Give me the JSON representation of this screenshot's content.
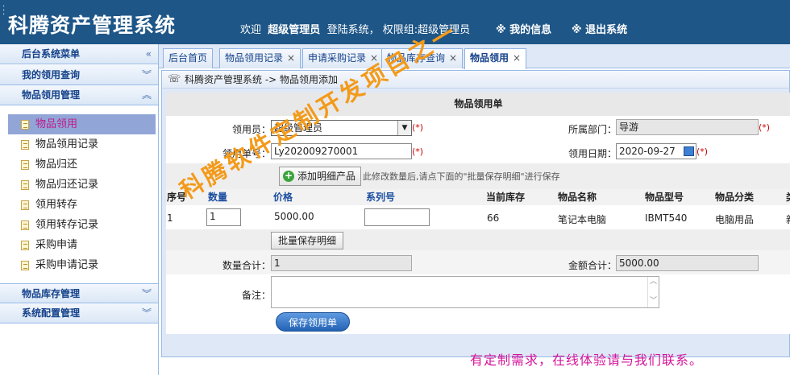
{
  "header": {
    "app_title": "科腾资产管理系统",
    "welcome_prefix": "欢迎",
    "user_name": "超级管理员",
    "welcome_suffix": "登陆系统， 权限组:超级管理员",
    "my_info": "※ 我的信息",
    "logout": "※ 退出系统"
  },
  "sidebar": {
    "menu_title": "后台系统菜单",
    "group_my_requests": "我的领用查询",
    "group_item_use": "物品领用管理",
    "items": [
      {
        "label": "物品领用"
      },
      {
        "label": "物品领用记录"
      },
      {
        "label": "物品归还"
      },
      {
        "label": "物品归还记录"
      },
      {
        "label": "领用转存"
      },
      {
        "label": "领用转存记录"
      },
      {
        "label": "采购申请"
      },
      {
        "label": "采购申请记录"
      }
    ],
    "group_inventory": "物品库存管理",
    "group_config": "系统配置管理"
  },
  "tabs": [
    {
      "label": "后台首页",
      "closable": false
    },
    {
      "label": "物品领用记录",
      "closable": true
    },
    {
      "label": "申请采购记录",
      "closable": true
    },
    {
      "label": "物品库存查询",
      "closable": true
    },
    {
      "label": "物品领用",
      "closable": true
    }
  ],
  "panel": {
    "breadcrumb": "科腾资产管理系统 -> 物品领用添加",
    "form_title": "物品领用单",
    "requester_label": "领用员：",
    "requester_value": "超级管理员",
    "required_mark": "(*)",
    "department_label": "所属部门：",
    "department_value": "导游",
    "order_no_label": "领用单号：",
    "order_no_value": "Ly202009270001",
    "date_label": "领用日期：",
    "date_value": "2020-09-27",
    "add_detail_btn": "添加明细产品",
    "hint_text": "此修改数量后,请点下面的\"批量保存明细\"进行保存",
    "table": {
      "headers": [
        "序号",
        "数量",
        "价格",
        "系列号",
        "当前库存",
        "物品名称",
        "物品型号",
        "物品分类",
        "类"
      ],
      "rows": [
        {
          "index": "1",
          "qty": "1",
          "price": "5000.00",
          "serial": "",
          "stock": "66",
          "name": "笔记本电脑",
          "model": "IBMT540",
          "category": "电脑用品",
          "extra": "新"
        }
      ]
    },
    "batch_save_btn": "批量保存明细",
    "qty_total_label": "数量合计：",
    "qty_total_value": "1",
    "amount_total_label": "金额合计：",
    "amount_total_value": "5000.00",
    "remark_label": "备注：",
    "save_btn": "保存领用单"
  },
  "watermark": "科腾软件定制开发项目之一",
  "footer_note": "有定制需求，在线体验请与我们联系。",
  "colors": {
    "header_bg": "#1e5687",
    "active_menu_bg": "#91a6d6",
    "active_menu_text": "#c0198d",
    "watermark": "#f39a1a",
    "footer_note": "#d6149b"
  }
}
